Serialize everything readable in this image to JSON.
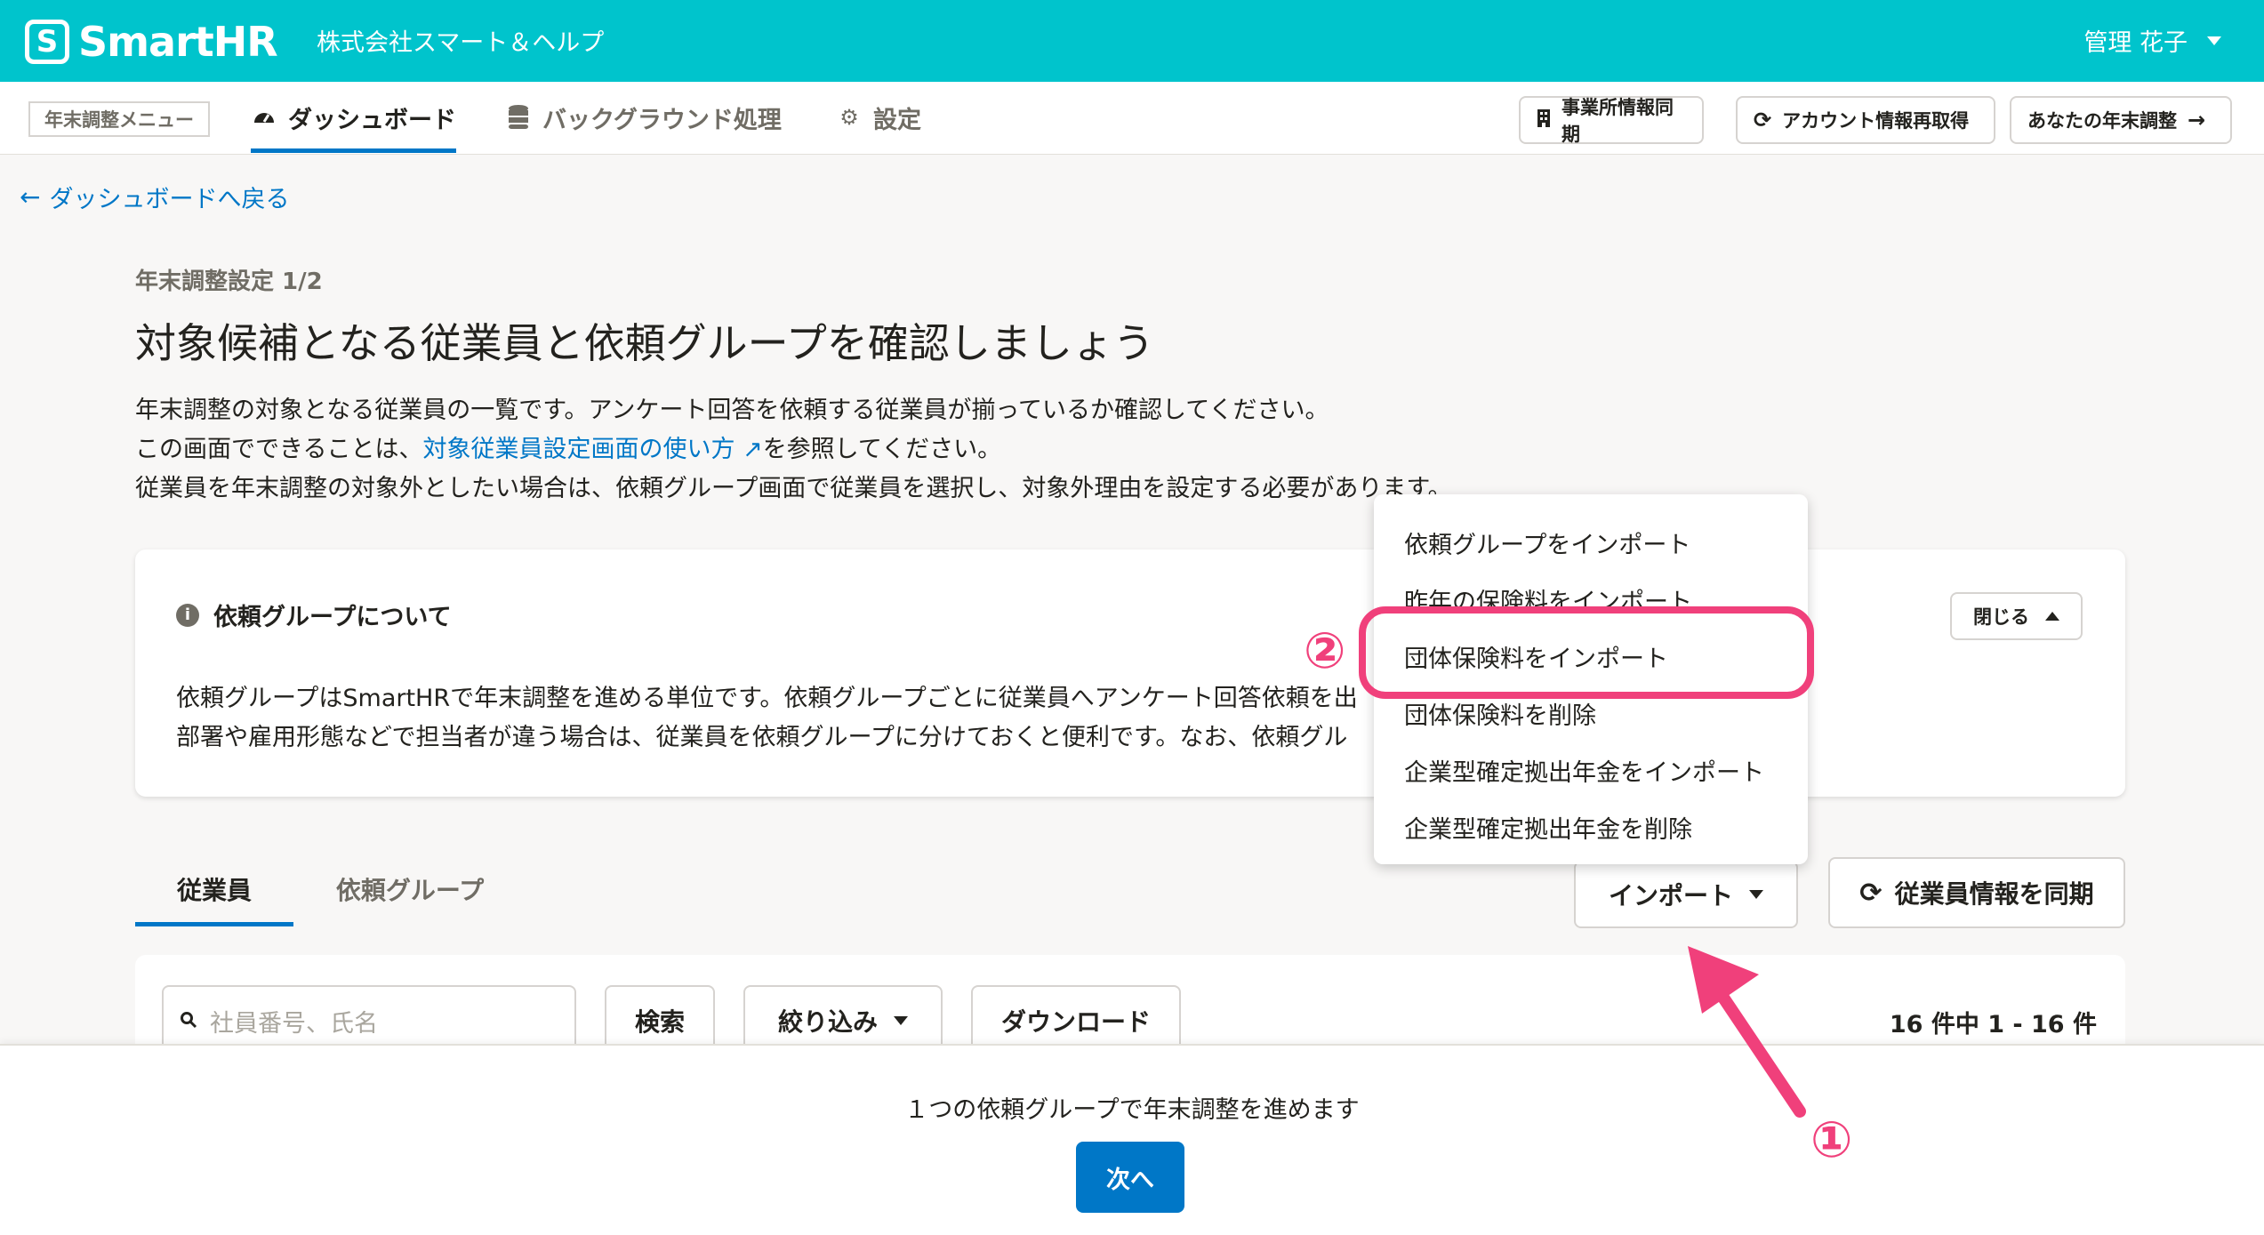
{
  "header": {
    "logo_mark": "S",
    "logo_text": "SmartHR",
    "company": "株式会社スマート＆ヘルプ",
    "user": "管理 花子"
  },
  "nav": {
    "menu_label": "年末調整メニュー",
    "items": [
      {
        "label": "ダッシュボード",
        "icon": "gauge-icon",
        "active": true
      },
      {
        "label": "バックグラウンド処理",
        "icon": "database-icon",
        "active": false
      },
      {
        "label": "設定",
        "icon": "gear-icon",
        "active": false
      }
    ],
    "buttons": [
      {
        "label": "事業所情報同期",
        "icon": "building-icon"
      },
      {
        "label": "アカウント情報再取得",
        "icon": "refresh-icon"
      },
      {
        "label": "あなたの年末調整",
        "icon": "arrow-right-icon"
      }
    ]
  },
  "back_link": "ダッシュボードへ戻る",
  "step": "年末調整設定 1/2",
  "title": "対象候補となる従業員と依頼グループを確認しましょう",
  "intro": {
    "line1": "年末調整の対象となる従業員の一覧です。アンケート回答を依頼する従業員が揃っているか確認してください。",
    "line2_pre": "この画面でできることは、",
    "line2_link": "対象従業員設定画面の使い方",
    "line2_post": "を参照してください。",
    "line3": "従業員を年末調整の対象外としたい場合は、依頼グループ画面で従業員を選択し、対象外理由を設定する必要があります。"
  },
  "info_card": {
    "heading": "依頼グループについて",
    "close_label": "閉じる",
    "body1": "依頼グループはSmartHRで年末調整を進める単位です。依頼グループごとに従業員へアンケート回答依頼を出",
    "body2": "部署や雇用形態などで担当者が違う場合は、従業員を依頼グループに分けておくと便利です。なお、依頼グル"
  },
  "tabs": [
    {
      "label": "従業員",
      "active": true
    },
    {
      "label": "依頼グループ",
      "active": false
    }
  ],
  "actions": {
    "import_label": "インポート",
    "sync_label": "従業員情報を同期"
  },
  "dropdown": {
    "items": [
      "依頼グループをインポート",
      "昨年の保険料をインポート",
      "団体保険料をインポート",
      "団体保険料を削除",
      "企業型確定拠出年金をインポート",
      "企業型確定拠出年金を削除"
    ]
  },
  "table": {
    "search_placeholder": "社員番号、氏名",
    "search_button": "検索",
    "filter_button": "絞り込み",
    "download_button": "ダウンロード",
    "count": "16 件中 1 - 16 件"
  },
  "bottom": {
    "text": "１つの依頼グループで年末調整を進めます",
    "next_label": "次へ"
  },
  "annotations": {
    "badge1": "①",
    "badge2": "②",
    "color": "#f0407b"
  },
  "colors": {
    "brand": "#00c4cc",
    "primary": "#0077c7"
  }
}
